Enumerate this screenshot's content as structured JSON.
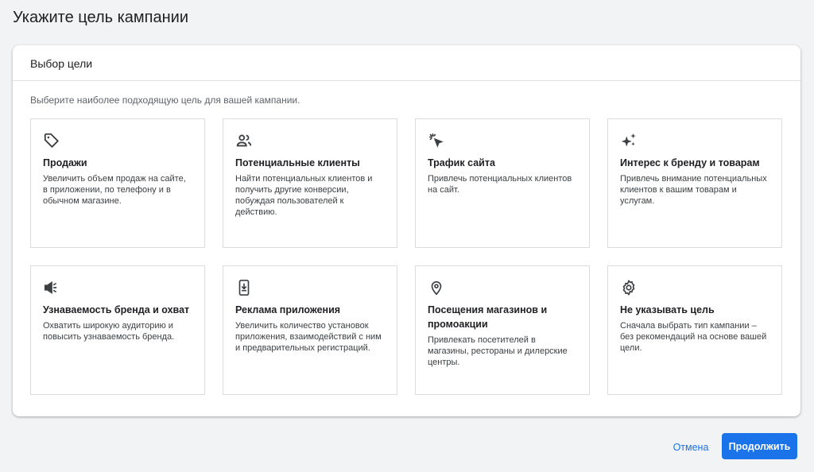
{
  "page": {
    "title": "Укажите цель кампании"
  },
  "card": {
    "header": "Выбор цели",
    "subtitle": "Выберите наиболее подходящую цель для вашей кампании."
  },
  "goals": [
    {
      "icon": "tag-icon",
      "title": "Продажи",
      "description": "Увеличить объем продаж на сайте, в приложении, по телефону и в обычном магазине."
    },
    {
      "icon": "people-icon",
      "title": "Потенциальные клиенты",
      "description": "Найти потенциальных клиентов и получить другие конверсии, побуждая пользователей к действию."
    },
    {
      "icon": "cursor-click-icon",
      "title": "Трафик сайта",
      "description": "Привлечь потенциальных клиентов на сайт."
    },
    {
      "icon": "sparkle-icon",
      "title": "Интерес к бренду и товарам",
      "description": "Привлечь внимание потенциальных клиентов к вашим товарам и услугам."
    },
    {
      "icon": "megaphone-icon",
      "title": "Узнаваемость бренда и охват",
      "description": "Охватить широкую аудиторию и повысить узнаваемость бренда."
    },
    {
      "icon": "phone-download-icon",
      "title": "Реклама приложения",
      "description": "Увеличить количество установок приложения, взаимодействий с ним и предварительных регистраций."
    },
    {
      "icon": "location-pin-icon",
      "title": "Посещения магазинов и промоакции",
      "description": "Привлекать посетителей в магазины, рестораны и дилерские центры."
    },
    {
      "icon": "gear-icon",
      "title": "Не указывать цель",
      "description": "Сначала выбрать тип кампании – без рекомендаций на основе вашей цели."
    }
  ],
  "actions": {
    "cancel": "Отмена",
    "continue": "Продолжить"
  },
  "colors": {
    "accent": "#1a73e8",
    "icon": "#3c4043",
    "border": "#dadce0"
  }
}
